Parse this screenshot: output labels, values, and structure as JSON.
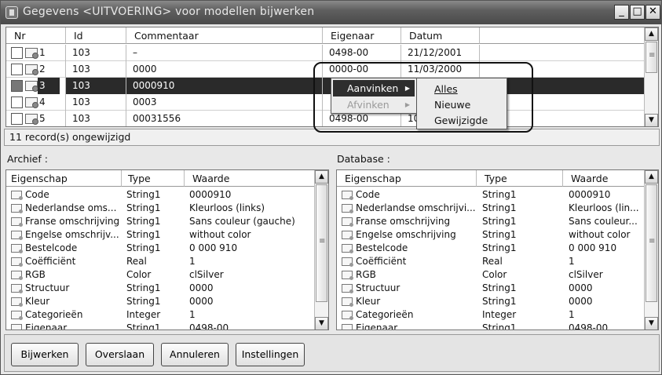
{
  "window": {
    "title": "Gegevens <UITVOERING> voor modellen bijwerken"
  },
  "titlebar_buttons": {
    "minimize": "_",
    "maximize": "□",
    "close": "✕"
  },
  "records": {
    "columns": [
      "Nr",
      "Id",
      "Commentaar",
      "Eigenaar",
      "Datum"
    ],
    "rows": [
      {
        "nr": "1",
        "id": "103",
        "commentaar": "–",
        "eigenaar": "0498-00",
        "datum": "21/12/2001",
        "checked": false
      },
      {
        "nr": "2",
        "id": "103",
        "commentaar": "0000",
        "eigenaar": "0000-00",
        "datum": "11/03/2000",
        "checked": false
      },
      {
        "nr": "3",
        "id": "103",
        "commentaar": "0000910",
        "eigenaar": "",
        "datum": "",
        "checked": true,
        "selected": true
      },
      {
        "nr": "4",
        "id": "103",
        "commentaar": "0003",
        "eigenaar": "",
        "datum": "",
        "checked": false
      },
      {
        "nr": "5",
        "id": "103",
        "commentaar": "00031556",
        "eigenaar": "0498-00",
        "datum": "10",
        "checked": false
      }
    ]
  },
  "status_text": "11 record(s) ongewijzigd",
  "context_menu": {
    "items": [
      {
        "label": "Aanvinken",
        "enabled": true,
        "active": true
      },
      {
        "label": "Afvinken",
        "enabled": false,
        "active": false
      }
    ],
    "submenu": [
      "Alles",
      "Nieuwe",
      "Gewijzigde"
    ]
  },
  "archief": {
    "label": "Archief :",
    "columns": [
      "Eigenschap",
      "Type",
      "Waarde"
    ],
    "rows": [
      {
        "prop": "Code",
        "type": "String1",
        "value": "0000910"
      },
      {
        "prop": "Nederlandse oms...",
        "type": "String1",
        "value": "Kleurloos (links)"
      },
      {
        "prop": "Franse omschrijving",
        "type": "String1",
        "value": "Sans couleur (gauche)"
      },
      {
        "prop": "Engelse omschrijv...",
        "type": "String1",
        "value": "without color"
      },
      {
        "prop": "Bestelcode",
        "type": "String1",
        "value": "0 000 910"
      },
      {
        "prop": "Coëfficiënt",
        "type": "Real",
        "value": "1"
      },
      {
        "prop": "RGB",
        "type": "Color",
        "value": "clSilver"
      },
      {
        "prop": "Structuur",
        "type": "String1",
        "value": "0000"
      },
      {
        "prop": "Kleur",
        "type": "String1",
        "value": "0000"
      },
      {
        "prop": "Categorieën",
        "type": "Integer",
        "value": "1"
      },
      {
        "prop": "Eigenaar",
        "type": "String1",
        "value": "0498-00"
      }
    ]
  },
  "database": {
    "label": "Database :",
    "columns": [
      "Eigenschap",
      "Type",
      "Waarde"
    ],
    "rows": [
      {
        "prop": "Code",
        "type": "String1",
        "value": "0000910"
      },
      {
        "prop": "Nederlandse omschrijvi...",
        "type": "String1",
        "value": "Kleurloos (lin..."
      },
      {
        "prop": "Franse omschrijving",
        "type": "String1",
        "value": "Sans couleur..."
      },
      {
        "prop": "Engelse omschrijving",
        "type": "String1",
        "value": "without color"
      },
      {
        "prop": "Bestelcode",
        "type": "String1",
        "value": "0 000 910"
      },
      {
        "prop": "Coëfficiënt",
        "type": "Real",
        "value": "1"
      },
      {
        "prop": "RGB",
        "type": "Color",
        "value": "clSilver"
      },
      {
        "prop": "Structuur",
        "type": "String1",
        "value": "0000"
      },
      {
        "prop": "Kleur",
        "type": "String1",
        "value": "0000"
      },
      {
        "prop": "Categorieën",
        "type": "Integer",
        "value": "1"
      },
      {
        "prop": "Eigenaar",
        "type": "String1",
        "value": "0498-00"
      }
    ]
  },
  "buttons": {
    "bijwerken": "Bijwerken",
    "overslaan": "Overslaan",
    "annuleren": "Annuleren",
    "instellingen": "Instellingen"
  },
  "scroll_arrows": {
    "up": "▲",
    "down": "▼"
  }
}
